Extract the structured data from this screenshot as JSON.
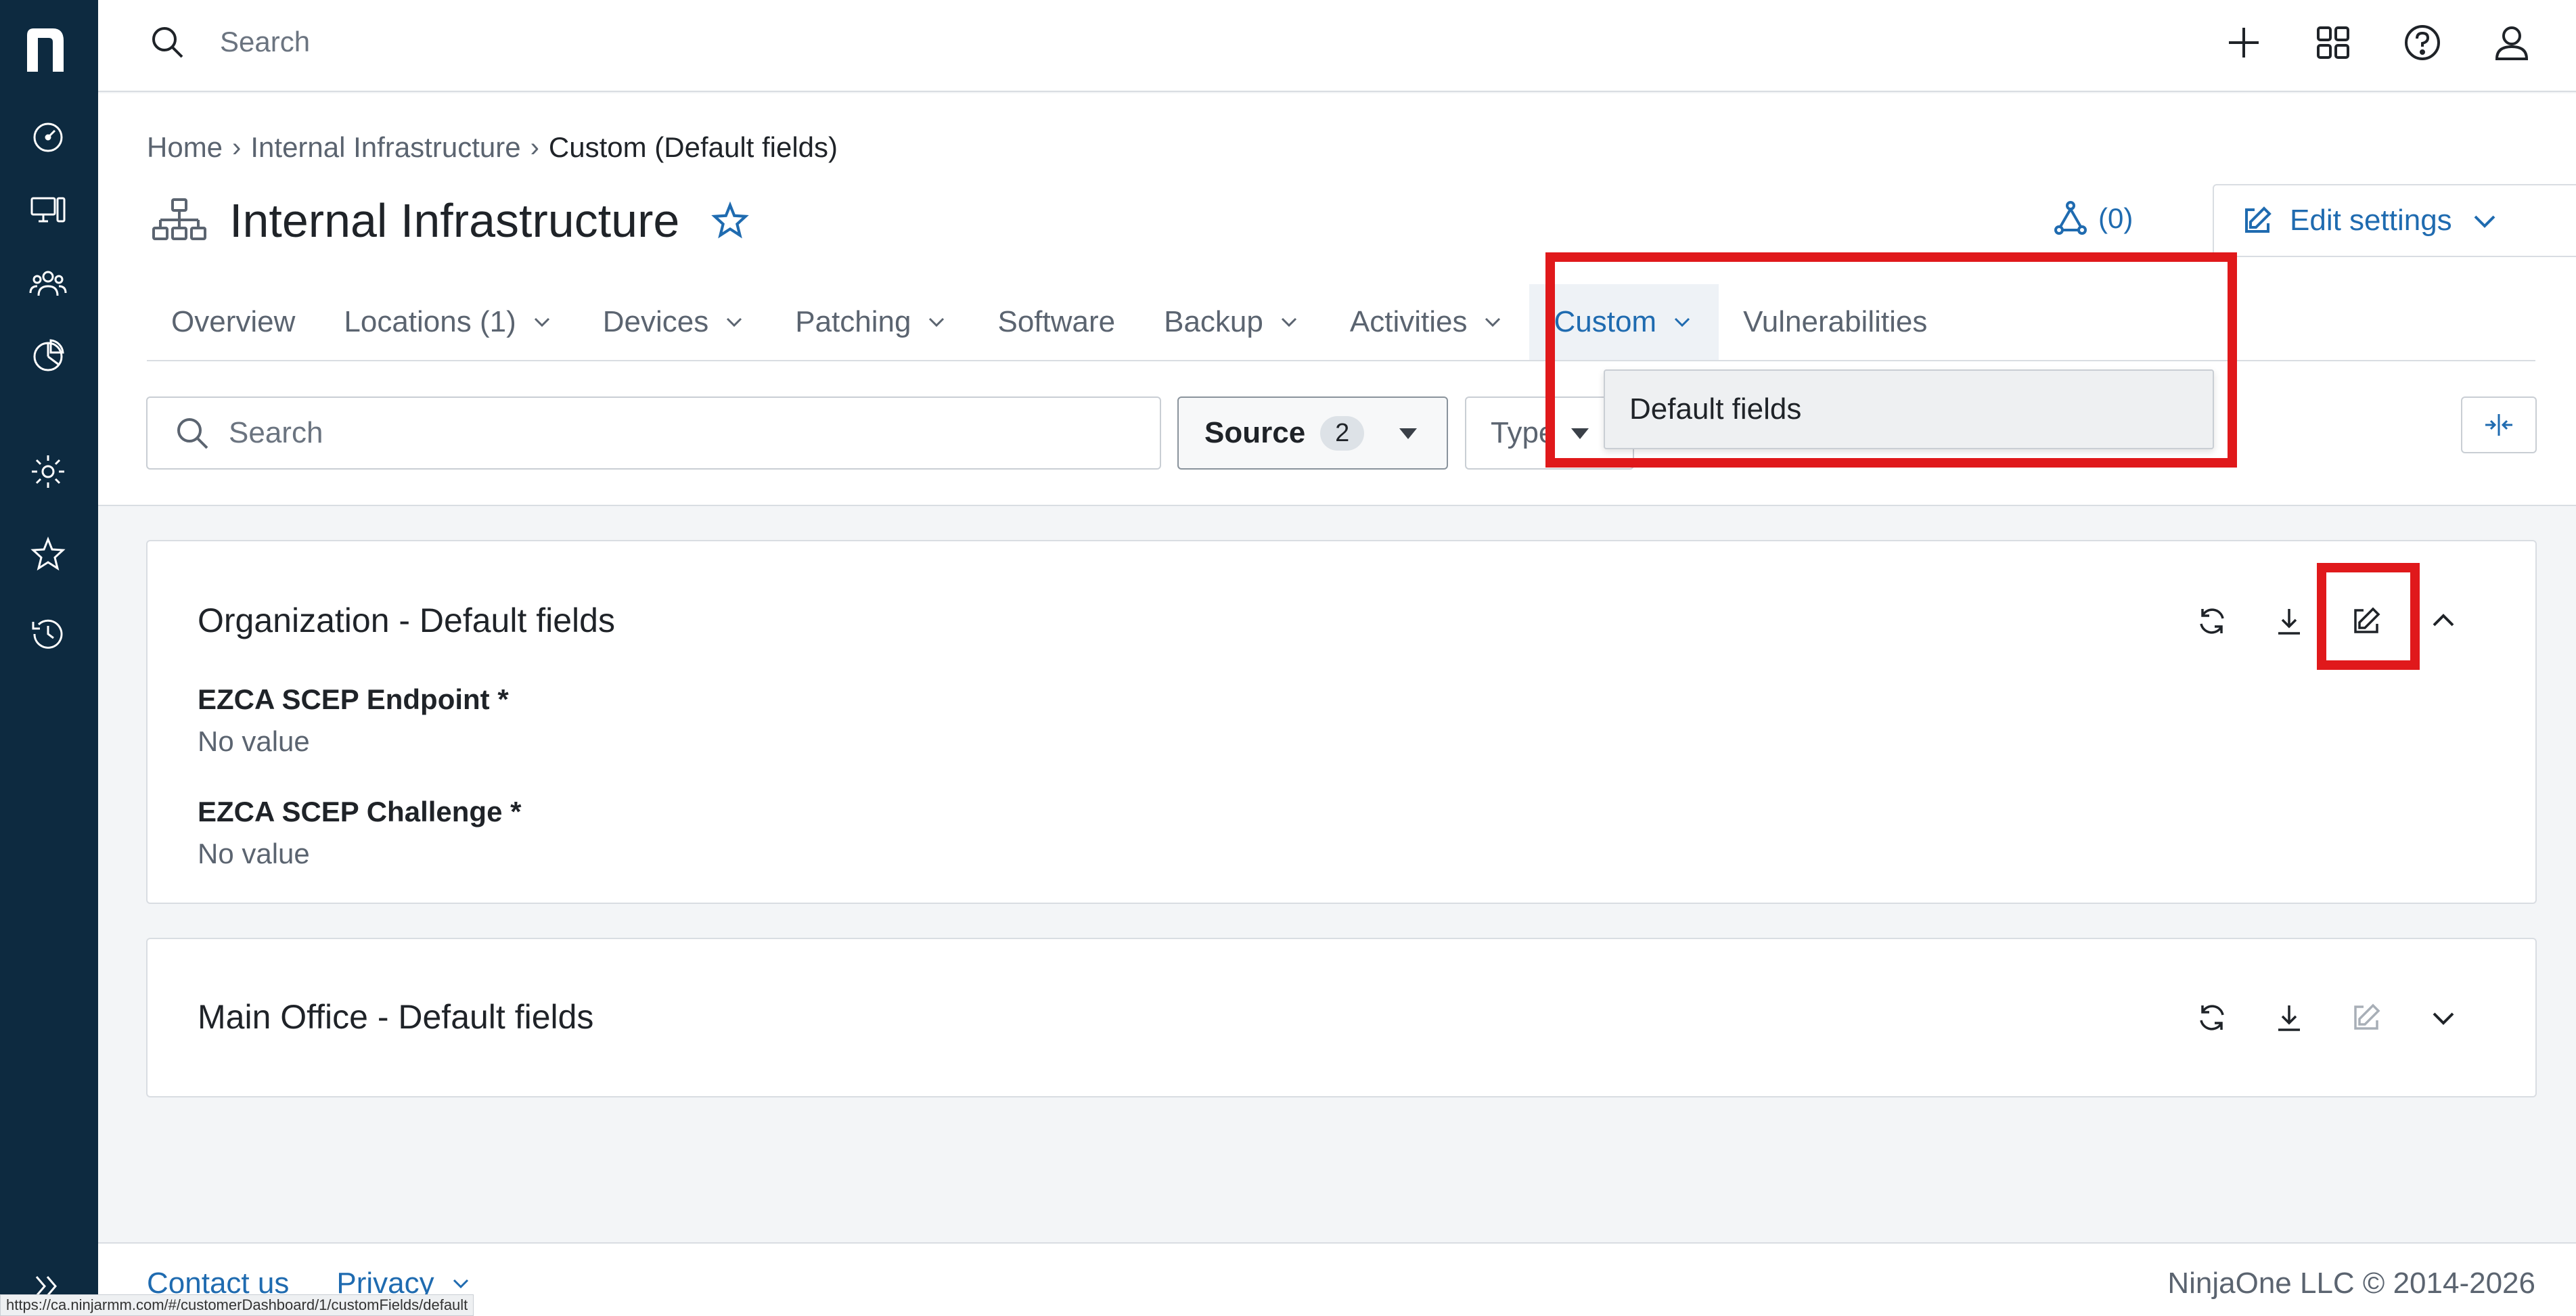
{
  "topbar": {
    "search_placeholder": "Search"
  },
  "breadcrumb": {
    "home": "Home",
    "org": "Internal Infrastructure",
    "current": "Custom (Default fields)"
  },
  "header": {
    "title": "Internal Infrastructure",
    "topology_count": "(0)",
    "edit_settings_label": "Edit settings"
  },
  "tabs": [
    {
      "label": "Overview"
    },
    {
      "label": "Locations (1)"
    },
    {
      "label": "Devices"
    },
    {
      "label": "Patching"
    },
    {
      "label": "Software"
    },
    {
      "label": "Backup"
    },
    {
      "label": "Activities"
    },
    {
      "label": "Custom"
    },
    {
      "label": "Vulnerabilities"
    }
  ],
  "dropdown": {
    "item": "Default fields"
  },
  "filters": {
    "search_placeholder": "Search",
    "source_label": "Source",
    "source_count": "2",
    "type_label": "Type"
  },
  "cards": [
    {
      "title": "Organization - Default fields",
      "fields": [
        {
          "label": "EZCA SCEP Endpoint *",
          "value": "No value"
        },
        {
          "label": "EZCA SCEP Challenge *",
          "value": "No value"
        }
      ]
    },
    {
      "title": "Main Office - Default fields"
    }
  ],
  "footer": {
    "contact": "Contact us",
    "privacy": "Privacy",
    "copyright": "NinjaOne LLC © 2014-2026"
  },
  "status_url": "https://ca.ninjarmm.com/#/customerDashboard/1/customFields/default",
  "colors": {
    "sidebar": "#0d2a40",
    "accent": "#1f6bb0",
    "highlight": "#e0191b"
  }
}
